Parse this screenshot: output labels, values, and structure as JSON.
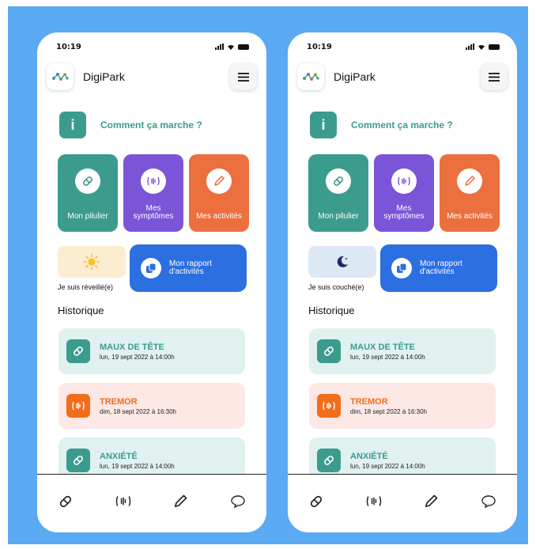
{
  "colors": {
    "background": "#5aaaf4",
    "accent_green": "#3b9c8e",
    "accent_purple": "#7a55d8",
    "accent_orange": "#ec6f3e",
    "tremor_orange": "#f26d1a",
    "report_blue": "#2c6fe0"
  },
  "screens": [
    {
      "status_bar": {
        "time": "10:19"
      },
      "header": {
        "app_name": "DigiPark",
        "logo_icon": "digipark-logo",
        "menu_icon": "hamburger-menu-icon"
      },
      "help": {
        "icon_text": "i",
        "label": "Comment ça marche ?"
      },
      "tiles": [
        {
          "label_line1": "Mon pilulier",
          "label_line2": "",
          "icon": "pill-icon"
        },
        {
          "label_line1": "Mes",
          "label_line2": "symptômes",
          "icon": "tremor-icon"
        },
        {
          "label_line1": "Mes activités",
          "label_line2": "",
          "icon": "pencil-icon"
        }
      ],
      "day_status": {
        "label": "Je suis réveillé(e)",
        "icon": "sun-icon"
      },
      "report": {
        "line1": "Mon rapport",
        "line2": "d'activités",
        "icon": "report-icon"
      },
      "history": {
        "title": "Historique",
        "entries": [
          {
            "title": "MAUX DE TÊTE",
            "date": "lun, 19 sept 2022 à 14:00h",
            "icon": "pill-icon",
            "kind": "medication"
          },
          {
            "title": "TREMOR",
            "date": "dim, 18 sept 2022 à 16:30h",
            "icon": "tremor-icon",
            "kind": "symptom"
          },
          {
            "title": "ANXIÉTÉ",
            "date": "lun, 19 sept 2022 à 14:00h",
            "icon": "pill-icon",
            "kind": "medication"
          }
        ]
      },
      "bottom_nav": [
        "pill-icon",
        "tremor-icon",
        "pencil-icon",
        "chat-bubble-icon"
      ]
    },
    {
      "status_bar": {
        "time": "10:19"
      },
      "header": {
        "app_name": "DigiPark",
        "logo_icon": "digipark-logo",
        "menu_icon": "hamburger-menu-icon"
      },
      "help": {
        "icon_text": "i",
        "label": "Comment ça marche ?"
      },
      "tiles": [
        {
          "label_line1": "Mon pilulier",
          "label_line2": "",
          "icon": "pill-icon"
        },
        {
          "label_line1": "Mes",
          "label_line2": "symptômes",
          "icon": "tremor-icon"
        },
        {
          "label_line1": "Mes activités",
          "label_line2": "",
          "icon": "pencil-icon"
        }
      ],
      "day_status": {
        "label": "Je suis couché(e)",
        "icon": "moon-icon"
      },
      "report": {
        "line1": "Mon rapport",
        "line2": "d'activités",
        "icon": "report-icon"
      },
      "history": {
        "title": "Historique",
        "entries": [
          {
            "title": "MAUX DE TÊTE",
            "date": "lun, 19 sept 2022 à 14:00h",
            "icon": "pill-icon",
            "kind": "medication"
          },
          {
            "title": "TREMOR",
            "date": "dim, 18 sept 2022 à 16:30h",
            "icon": "tremor-icon",
            "kind": "symptom"
          },
          {
            "title": "ANXIÉTÉ",
            "date": "lun, 19 sept 2022 à 14:00h",
            "icon": "pill-icon",
            "kind": "medication"
          }
        ]
      },
      "bottom_nav": [
        "pill-icon",
        "tremor-icon",
        "pencil-icon",
        "chat-bubble-icon"
      ]
    }
  ]
}
